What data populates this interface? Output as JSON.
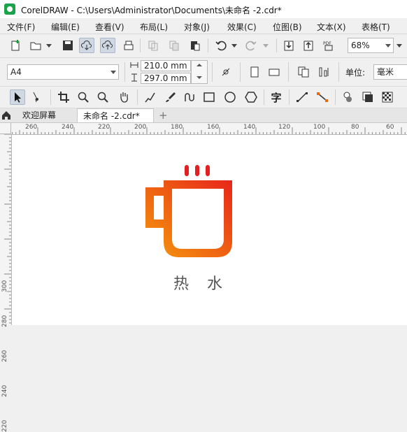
{
  "window": {
    "title": "CorelDRAW - C:\\Users\\Administrator\\Documents\\未命名 -2.cdr*"
  },
  "menu": [
    "文件(F)",
    "编辑(E)",
    "查看(V)",
    "布局(L)",
    "对象(J)",
    "效果(C)",
    "位图(B)",
    "文本(X)",
    "表格(T)"
  ],
  "toolbar": {
    "zoom_value": "68%",
    "icons": [
      "new-document-icon",
      "open-icon",
      "save-icon",
      "cloud-download-icon",
      "cloud-upload-icon",
      "print-icon",
      "copy-disabled-icon",
      "paste-disabled-icon",
      "clipboard-icon",
      "undo-icon",
      "redo-icon",
      "import-icon",
      "export-icon",
      "pdf-icon"
    ]
  },
  "property_bar": {
    "page_size": "A4",
    "width": "210.0 mm",
    "height": "297.0 mm",
    "units_label": "单位:",
    "units_value": "毫米"
  },
  "tools": [
    "pick-tool-icon",
    "shape-tool-icon",
    "crop-tool-icon",
    "zoom-tool-icon",
    "zoom-out-icon",
    "pan-tool-icon",
    "freehand-tool-icon",
    "artistic-media-icon",
    "curve-tool-icon",
    "rectangle-tool-icon",
    "ellipse-tool-icon",
    "polygon-tool-icon",
    "text-tool-icon",
    "line-tool-icon",
    "connector-tool-icon",
    "shadow-tool-icon",
    "transparency-tool-icon",
    "pattern-tool-icon"
  ],
  "text_tool_glyph": "字",
  "tabs": {
    "home_label": "欢迎屏幕",
    "document_label": "未命名 -2.cdr*",
    "add_label": "+"
  },
  "ruler": {
    "h_labels": [
      "260",
      "240",
      "220",
      "200",
      "180",
      "160",
      "140",
      "120",
      "100",
      "80",
      "60"
    ],
    "v_labels": [
      "300",
      "280",
      "260",
      "240",
      "220"
    ]
  },
  "artwork": {
    "caption": "热　水",
    "gradient_start": "#f59a0c",
    "gradient_end": "#e8261a",
    "steam_color": "#e51f1f"
  }
}
